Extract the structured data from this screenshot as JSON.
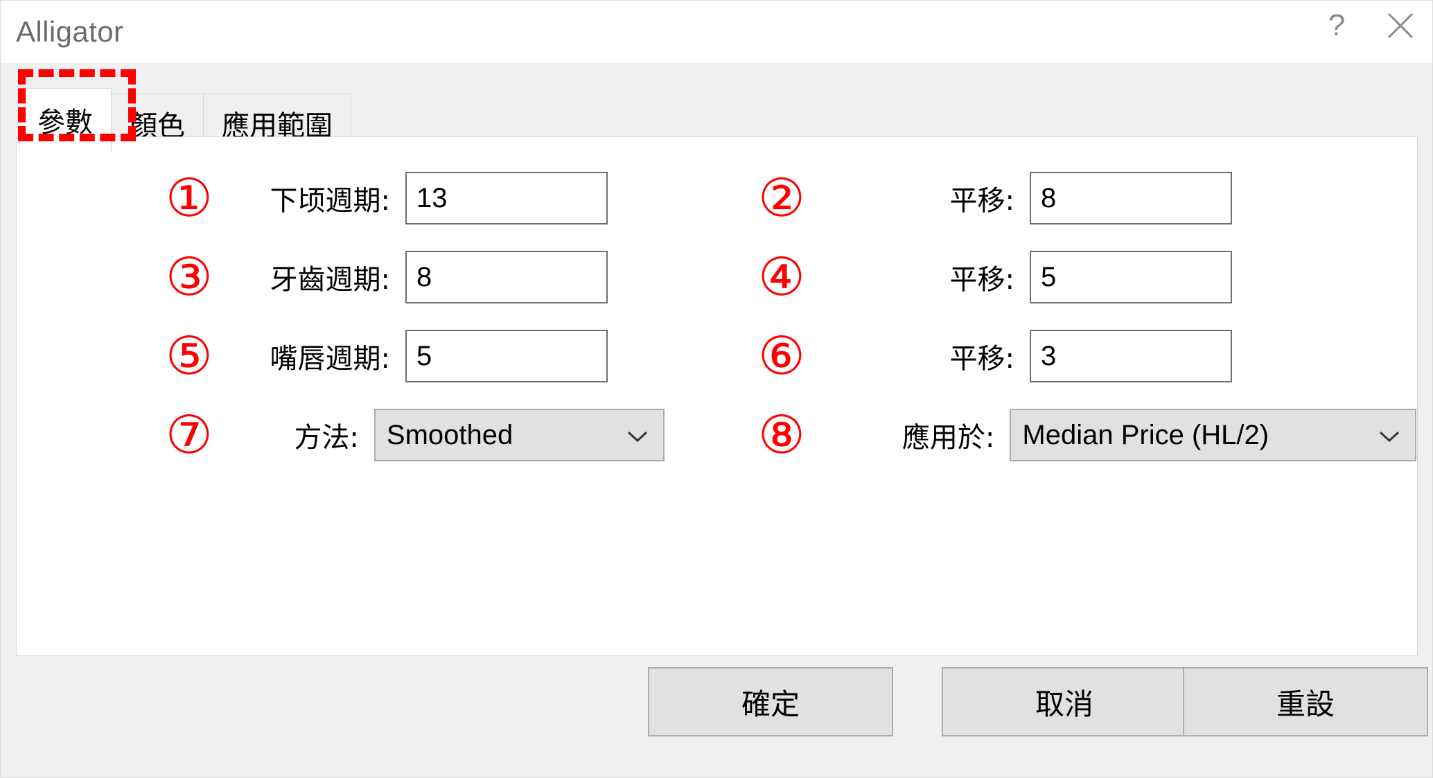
{
  "window": {
    "title": "Alligator",
    "help_icon": "?",
    "help_icon_name": "help-icon",
    "close_icon": "✕",
    "close_icon_name": "close-icon"
  },
  "tabs": [
    {
      "label": "參數",
      "active": true
    },
    {
      "label": "顏色",
      "active": false
    },
    {
      "label": "應用範圍",
      "active": false
    }
  ],
  "fields": {
    "left": [
      {
        "marker": "①",
        "label": "下顷週期:",
        "value": "13"
      },
      {
        "marker": "③",
        "label": "牙齒週期:",
        "value": "8"
      },
      {
        "marker": "⑤",
        "label": "嘴唇週期:",
        "value": "5"
      }
    ],
    "right": [
      {
        "marker": "②",
        "label": "平移:",
        "value": "8"
      },
      {
        "marker": "④",
        "label": "平移:",
        "value": "5"
      },
      {
        "marker": "⑥",
        "label": "平移:",
        "value": "3"
      }
    ],
    "method": {
      "marker": "⑦",
      "label": "方法:",
      "value": "Smoothed",
      "caret": "⌄"
    },
    "apply_to": {
      "marker": "⑧",
      "label": "應用於:",
      "value": "Median Price (HL/2)",
      "caret": "⌄"
    }
  },
  "footer": {
    "ok": "確定",
    "cancel": "取消",
    "reset": "重設"
  },
  "annotation": {
    "color": "#FF0000"
  }
}
